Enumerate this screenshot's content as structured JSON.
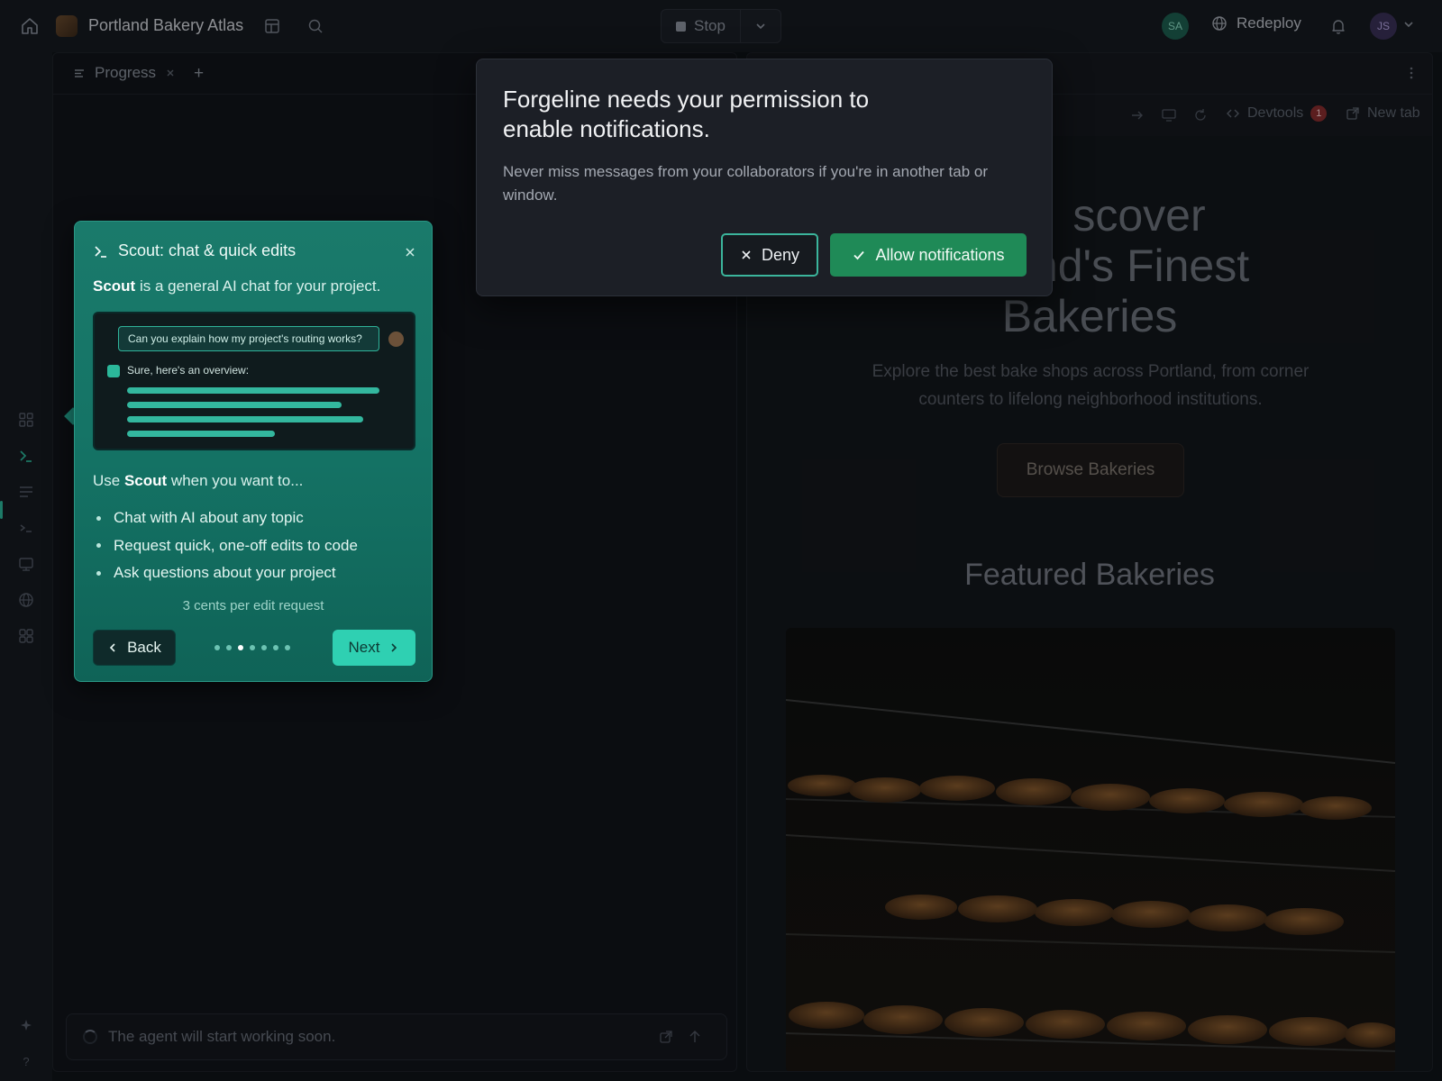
{
  "app": {
    "title": "Portland Bakery Atlas",
    "run_button": "Stop",
    "presence_avatar": "SA",
    "deploy_label": "Redeploy",
    "user_avatar": "JS"
  },
  "left_panel": {
    "tab_label": "Progress",
    "composer_placeholder": "The agent will start working soon."
  },
  "preview": {
    "devtools_label": "Devtools",
    "devtools_badge": "1",
    "new_tab_label": "New tab",
    "hero_title_line1": "scover",
    "hero_title_line2": "nd's Finest",
    "hero_title_line3": "Bakeries",
    "hero_subtitle": "Explore the best bake shops across Portland, from corner counters to lifelong neighborhood institutions.",
    "cta_label": "Browse Bakeries",
    "section_title": "Featured Bakeries"
  },
  "tour": {
    "title": "Scout: chat & quick edits",
    "intro_strong": "Scout",
    "intro_rest": " is a general AI chat for your project.",
    "demo_question": "Can you explain how my project's routing works?",
    "demo_reply": "Sure, here's an overview:",
    "use_prefix": "Use ",
    "use_strong": "Scout",
    "use_suffix": " when you want to...",
    "bullets": [
      "Chat with AI about any topic",
      "Request quick, one-off edits to code",
      "Ask questions about your project"
    ],
    "cost_note": "3 cents per edit request",
    "back_label": "Back",
    "next_label": "Next",
    "step_count": 7,
    "current_step": 3
  },
  "permission_dialog": {
    "title": "Forgeline needs your permission to enable notifications.",
    "body": "Never miss messages from your collaborators if you're in another tab or window.",
    "deny_label": "Deny",
    "allow_label": "Allow notifications"
  },
  "colors": {
    "accent_teal": "#1a7a6b",
    "allow_green": "#1f8a57",
    "badge_red": "#8a2b2b"
  }
}
